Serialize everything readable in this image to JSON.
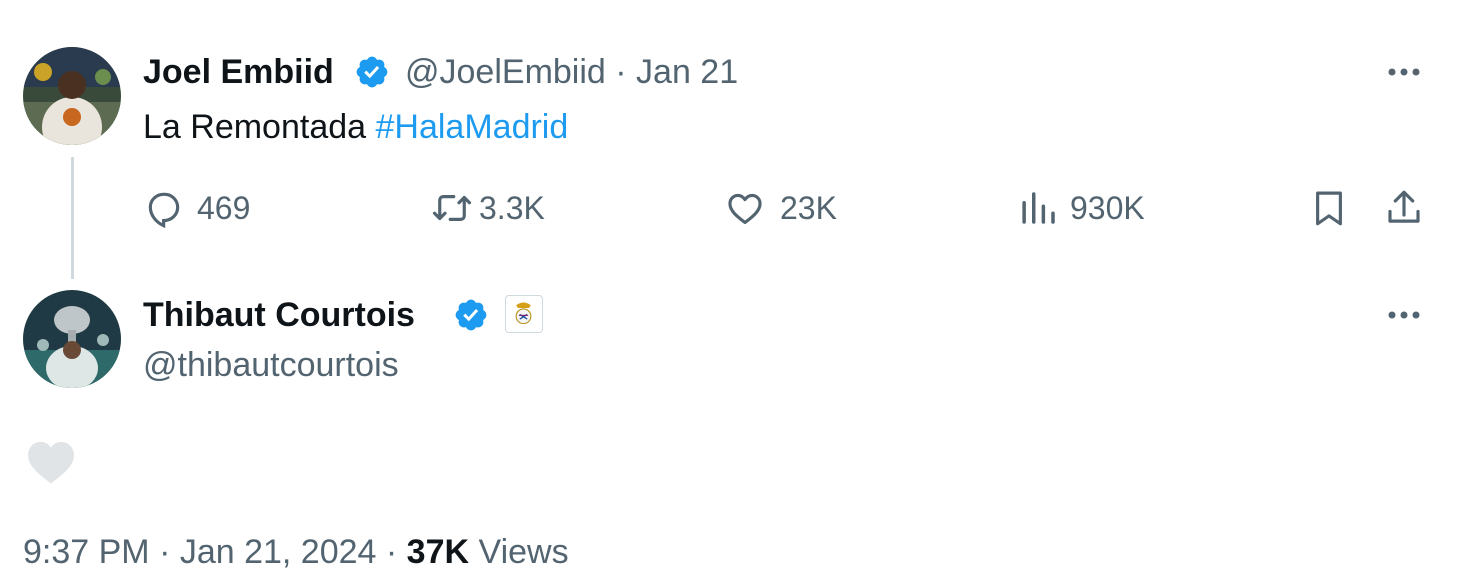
{
  "tweet": {
    "author_name": "Joel Embiid",
    "handle": "@JoelEmbiid",
    "separator": "·",
    "date": "Jan 21",
    "text": "La Remontada",
    "hashtag": "#HalaMadrid",
    "actions": {
      "replies": "469",
      "retweets": "3.3K",
      "likes": "23K",
      "views": "930K"
    }
  },
  "reply": {
    "author_name": "Thibaut Courtois",
    "handle": "@thibautcourtois"
  },
  "footer": {
    "time_date": "9:37 PM · Jan 21, 2024 ·",
    "views_count": "37K",
    "views_label": "Views"
  },
  "icons": {
    "verified": "verified-badge-icon",
    "more": "more-dots-icon",
    "reply": "reply-bubble-icon",
    "retweet": "retweet-icon",
    "like": "heart-icon",
    "views": "views-bar-chart-icon",
    "bookmark": "bookmark-icon",
    "share": "share-upload-icon",
    "affiliate": "real-madrid-crest-icon"
  },
  "colors": {
    "text_primary": "#0f1419",
    "text_secondary": "#536471",
    "accent": "#1d9bf0",
    "thread_line": "#cfd9de",
    "like_placeholder": "#e1e4e6"
  }
}
